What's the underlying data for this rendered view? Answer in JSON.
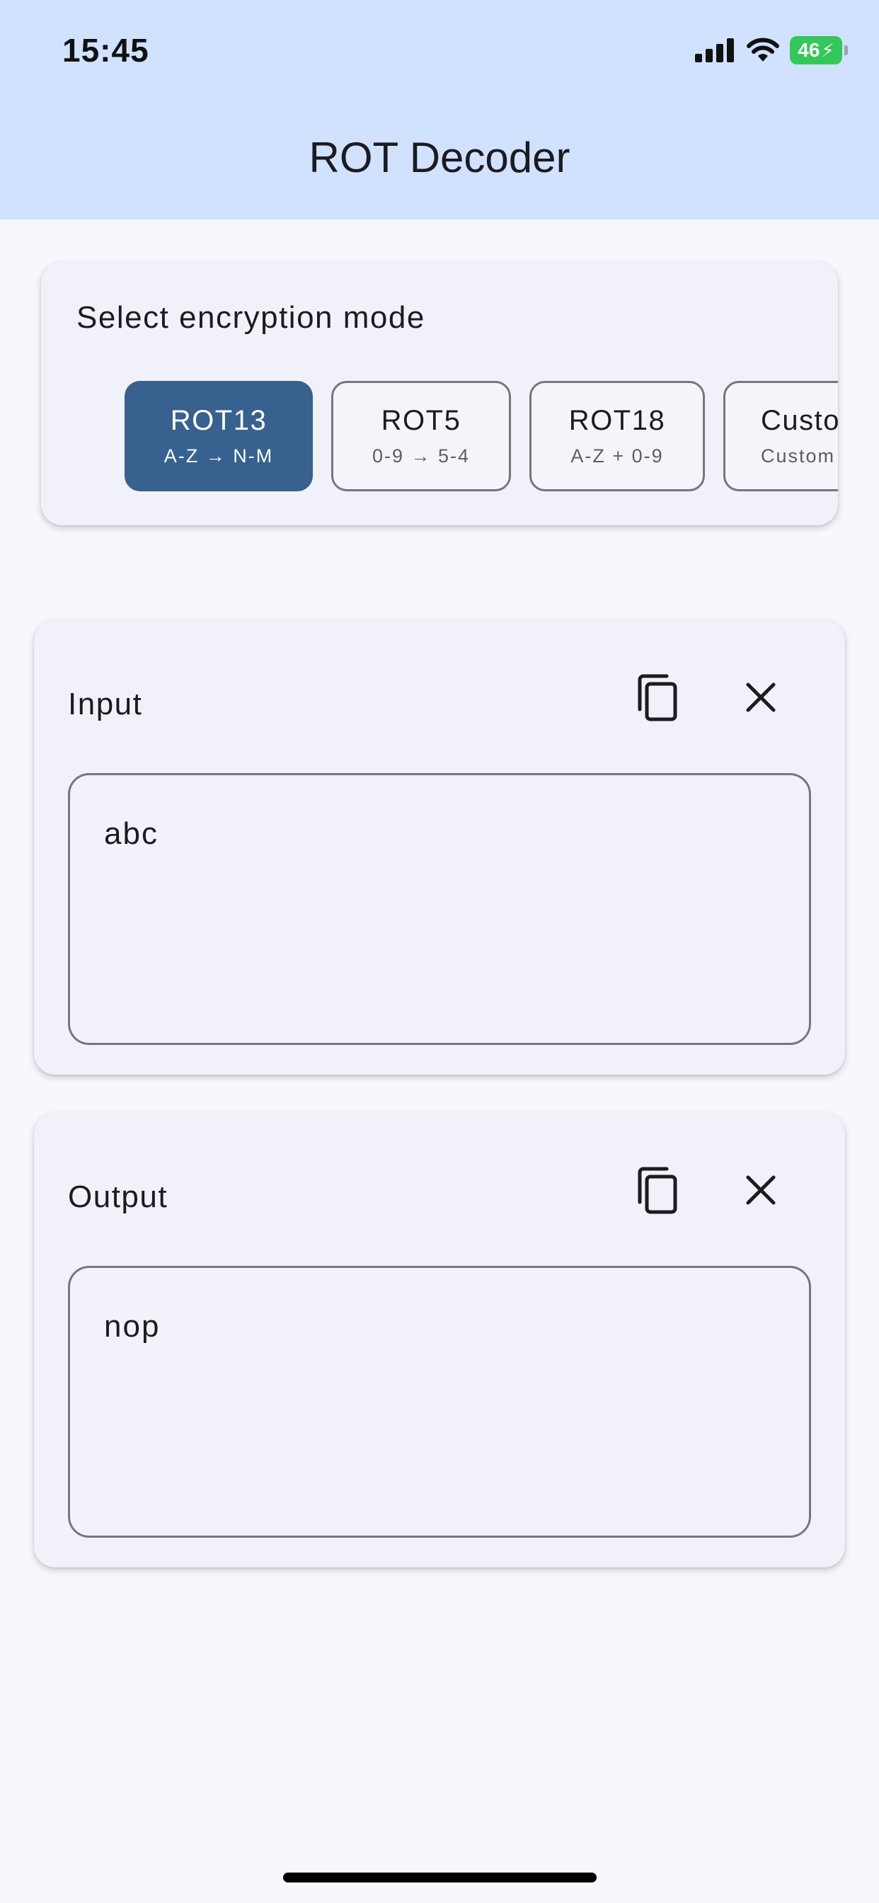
{
  "status_bar": {
    "time": "15:45",
    "battery": "46",
    "icons": [
      "cellular-signal-icon",
      "wifi-icon",
      "battery-charging-icon"
    ]
  },
  "app_bar": {
    "title": "ROT Decoder"
  },
  "mode_selector": {
    "title": "Select encryption mode",
    "modes": [
      {
        "label": "ROT13",
        "sub": "A-Z → N-M",
        "selected": true
      },
      {
        "label": "ROT5",
        "sub": "0-9 → 5-4",
        "selected": false
      },
      {
        "label": "ROT18",
        "sub": "A-Z + 0-9",
        "selected": false
      },
      {
        "label": "Custo",
        "sub": "Custom",
        "selected": false
      }
    ]
  },
  "input": {
    "title": "Input",
    "value": "abc",
    "copy_icon": "copy-icon",
    "clear_icon": "close-icon"
  },
  "output": {
    "title": "Output",
    "value": "nop",
    "copy_icon": "copy-icon",
    "clear_icon": "close-icon"
  },
  "colors": {
    "header_bg": "#d0e2fe",
    "page_bg": "#f7f8fd",
    "card_bg": "#f1f2f9",
    "selected_chip": "#37618f",
    "outline": "#79747e",
    "battery": "#34c759"
  }
}
